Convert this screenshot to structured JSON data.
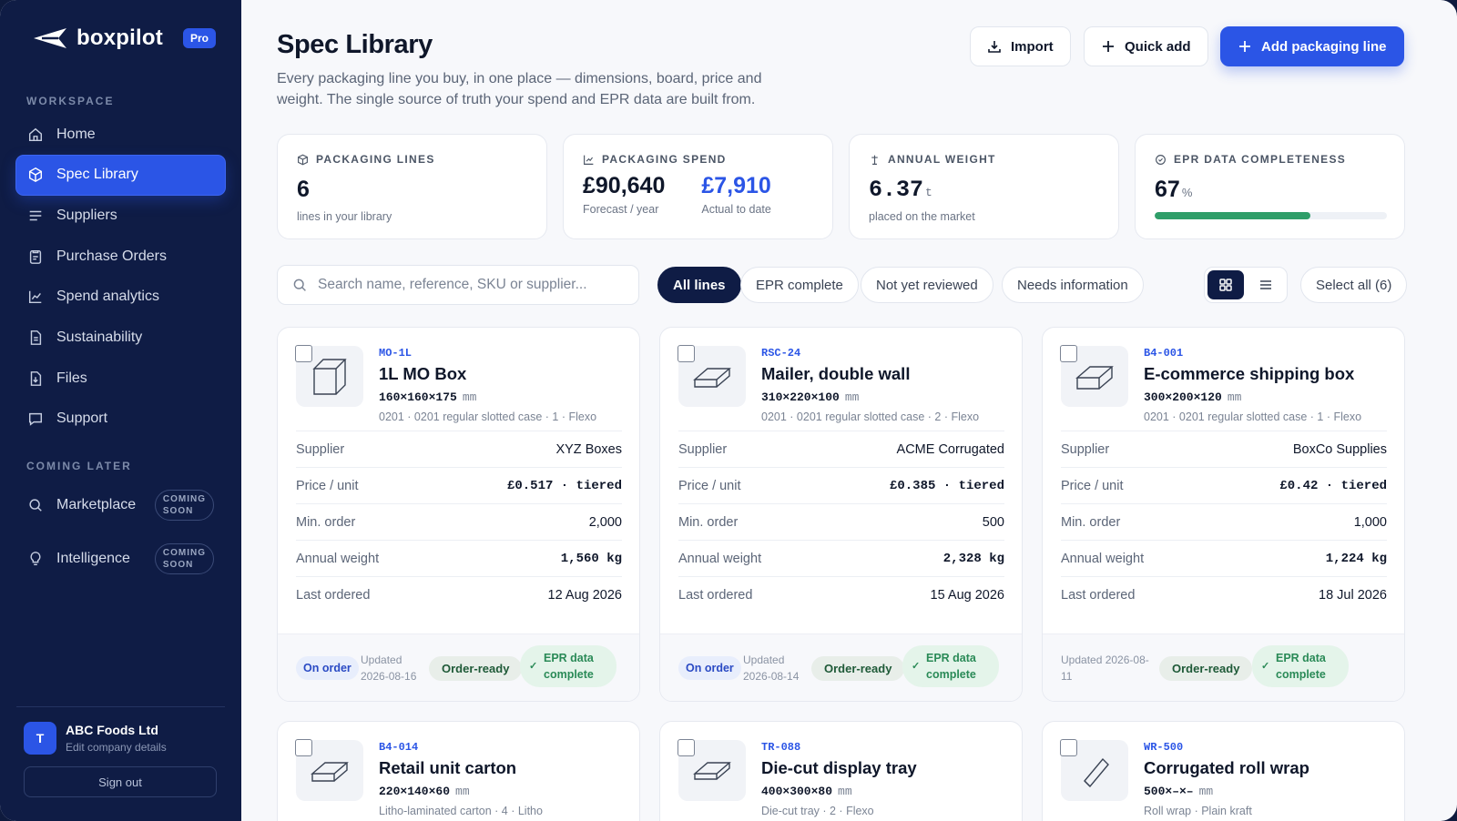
{
  "brand": {
    "name": "boxpilot",
    "plan": "Pro"
  },
  "sidebar": {
    "workspace_label": "WORKSPACE",
    "items": [
      {
        "label": "Home",
        "icon": "home-icon"
      },
      {
        "label": "Spec Library",
        "icon": "box-icon",
        "active": true
      },
      {
        "label": "Suppliers",
        "icon": "list-icon"
      },
      {
        "label": "Purchase Orders",
        "icon": "clipboard-icon"
      },
      {
        "label": "Spend analytics",
        "icon": "chart-icon"
      },
      {
        "label": "Sustainability",
        "icon": "document-icon"
      },
      {
        "label": "Files",
        "icon": "file-download-icon"
      },
      {
        "label": "Support",
        "icon": "chat-icon"
      }
    ],
    "later_label": "COMING LATER",
    "later_items": [
      {
        "label": "Marketplace",
        "icon": "search-icon",
        "badge_line1": "COMING",
        "badge_line2": "SOON"
      },
      {
        "label": "Intelligence",
        "icon": "lightbulb-icon",
        "badge_line1": "COMING",
        "badge_line2": "SOON"
      }
    ],
    "account": {
      "initial": "T",
      "name": "ABC Foods Ltd",
      "sub": "Edit company details"
    },
    "signout": "Sign out"
  },
  "header": {
    "title": "Spec Library",
    "subtitle": "Every packaging line you buy, in one place — dimensions, board, price and weight. The single source of truth your spend and EPR data are built from.",
    "import": "Import",
    "quick_add": "Quick add",
    "add_line": "Add packaging line"
  },
  "stats": {
    "lines": {
      "label": "PACKAGING LINES",
      "value": "6",
      "sub": "lines in your library"
    },
    "spend": {
      "label": "PACKAGING SPEND",
      "forecast": "£90,640",
      "forecast_sub": "Forecast / year",
      "actual": "£7,910",
      "actual_sub": "Actual to date"
    },
    "weight": {
      "label": "ANNUAL WEIGHT",
      "value": "6.37",
      "unit": "t",
      "sub": "placed on the market"
    },
    "epr": {
      "label": "EPR DATA COMPLETENESS",
      "value": "67",
      "unit": "%",
      "progress": 0.67
    }
  },
  "filters": {
    "search_placeholder": "Search name, reference, SKU or supplier...",
    "chips": [
      "All lines",
      "EPR complete",
      "Not yet reviewed",
      "Needs information"
    ],
    "select_all": "Select all (6)"
  },
  "row_labels": {
    "supplier": "Supplier",
    "price": "Price / unit",
    "min": "Min. order",
    "weight": "Annual weight",
    "last": "Last ordered"
  },
  "badges": {
    "on_order": "On order",
    "ready": "Order-ready",
    "epr1": "EPR data",
    "epr2": "complete"
  },
  "cards": [
    {
      "ref": "MO-1L",
      "name": "1L MO Box",
      "dims": "160×160×175",
      "mm": "mm",
      "desc": "0201 · 0201 regular slotted case · 1 · Flexo",
      "supplier": "XYZ Boxes",
      "price": "£0.517 · tiered",
      "min": "2,000",
      "weight": "1,560 kg",
      "last": "12 Aug 2026",
      "updated1": "Updated",
      "updated2": "2026-08-16",
      "on_order": true
    },
    {
      "ref": "RSC-24",
      "name": "Mailer, double wall",
      "dims": "310×220×100",
      "mm": "mm",
      "desc": "0201 · 0201 regular slotted case · 2 · Flexo",
      "supplier": "ACME Corrugated",
      "price": "£0.385 · tiered",
      "min": "500",
      "weight": "2,328 kg",
      "last": "15 Aug 2026",
      "updated1": "Updated",
      "updated2": "2026-08-14",
      "on_order": true
    },
    {
      "ref": "B4-001",
      "name": "E-commerce shipping box",
      "dims": "300×200×120",
      "mm": "mm",
      "desc": "0201 · 0201 regular slotted case · 1 · Flexo",
      "supplier": "BoxCo Supplies",
      "price": "£0.42 · tiered",
      "min": "1,000",
      "weight": "1,224 kg",
      "last": "18 Jul 2026",
      "updated1": "Updated 2026-08-",
      "updated2": "11",
      "on_order": false
    },
    {
      "ref": "B4-014",
      "name": "Retail unit carton",
      "dims": "220×140×60",
      "mm": "mm",
      "desc": "Litho-laminated carton · 4 · Litho"
    },
    {
      "ref": "TR-088",
      "name": "Die-cut display tray",
      "dims": "400×300×80",
      "mm": "mm",
      "desc": "Die-cut tray · 2 · Flexo"
    },
    {
      "ref": "WR-500",
      "name": "Corrugated roll wrap",
      "dims": "500×–×–",
      "mm": "mm",
      "desc": "Roll wrap · Plain kraft"
    }
  ]
}
